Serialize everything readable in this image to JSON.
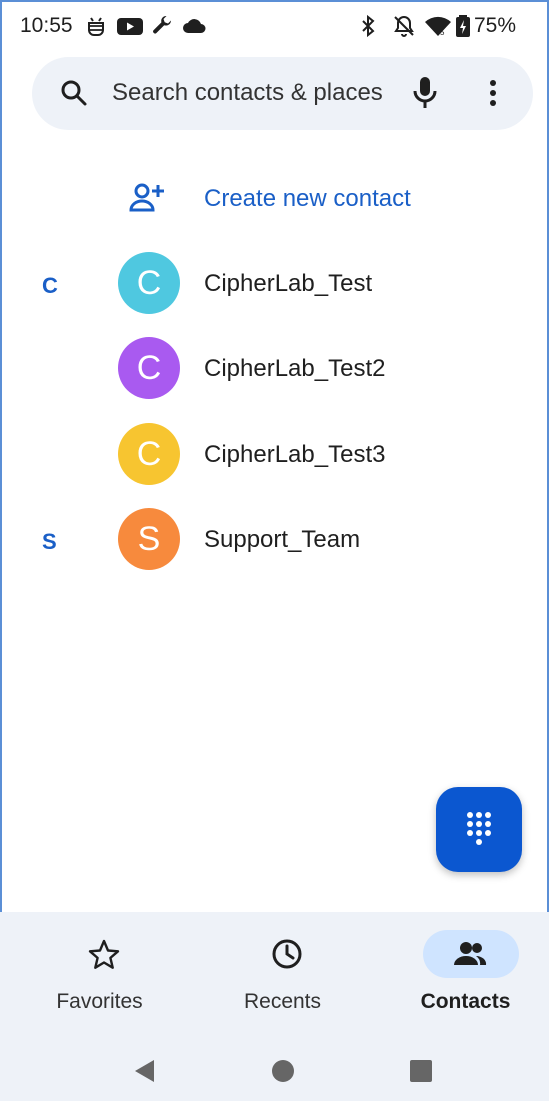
{
  "status_bar": {
    "time": "10:55",
    "battery": "75%",
    "left_icons": [
      "android-debug-icon",
      "youtube-icon",
      "wrench-icon",
      "cloud-icon"
    ],
    "right_icons": [
      "bluetooth-icon",
      "notifications-off-icon",
      "wifi-icon",
      "battery-icon"
    ]
  },
  "search": {
    "placeholder": "Search contacts & places"
  },
  "create_contact": {
    "label": "Create new contact"
  },
  "sections": [
    {
      "letter": "C"
    },
    {
      "letter": "S"
    }
  ],
  "contacts": [
    {
      "initial": "C",
      "name": "CipherLab_Test",
      "color": "#4fc8e0"
    },
    {
      "initial": "C",
      "name": "CipherLab_Test2",
      "color": "#a95af0"
    },
    {
      "initial": "C",
      "name": "CipherLab_Test3",
      "color": "#f7c530"
    },
    {
      "initial": "S",
      "name": "Support_Team",
      "color": "#f78a3d"
    }
  ],
  "bottom_nav": {
    "items": [
      {
        "label": "Favorites",
        "icon": "star-icon",
        "active": false
      },
      {
        "label": "Recents",
        "icon": "clock-icon",
        "active": false
      },
      {
        "label": "Contacts",
        "icon": "people-icon",
        "active": true
      }
    ]
  },
  "colors": {
    "accent": "#1a5fc7",
    "fab": "#0b57d0",
    "surface": "#eef2f8",
    "active_pill": "#cfe4ff"
  }
}
